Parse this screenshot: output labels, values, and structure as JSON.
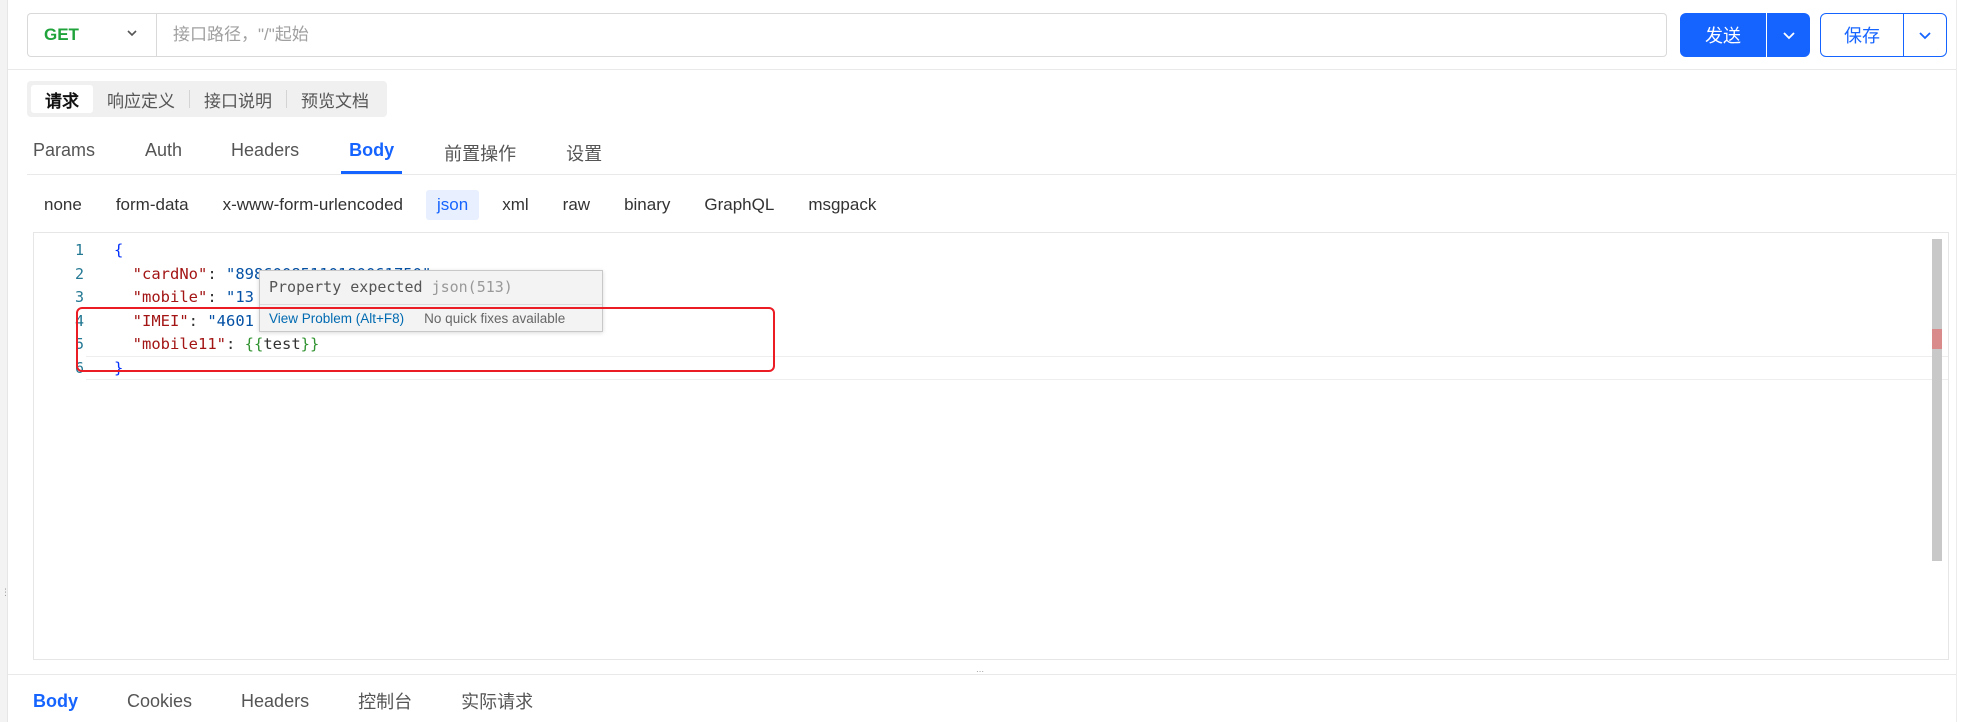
{
  "toolbar": {
    "method": "GET",
    "url_placeholder": "接口路径，\"/\"起始",
    "url_value": "",
    "send_label": "发送",
    "save_label": "保存"
  },
  "api_tabs": [
    {
      "label": "请求",
      "active": true
    },
    {
      "label": "响应定义",
      "active": false
    },
    {
      "label": "接口说明",
      "active": false
    },
    {
      "label": "预览文档",
      "active": false
    }
  ],
  "request_tabs": [
    {
      "label": "Params",
      "active": false
    },
    {
      "label": "Auth",
      "active": false
    },
    {
      "label": "Headers",
      "active": false
    },
    {
      "label": "Body",
      "active": true
    },
    {
      "label": "前置操作",
      "active": false
    },
    {
      "label": "设置",
      "active": false
    }
  ],
  "body_types": [
    {
      "label": "none",
      "active": false
    },
    {
      "label": "form-data",
      "active": false
    },
    {
      "label": "x-www-form-urlencoded",
      "active": false
    },
    {
      "label": "json",
      "active": true
    },
    {
      "label": "xml",
      "active": false
    },
    {
      "label": "raw",
      "active": false
    },
    {
      "label": "binary",
      "active": false
    },
    {
      "label": "GraphQL",
      "active": false
    },
    {
      "label": "msgpack",
      "active": false
    }
  ],
  "editor": {
    "line_numbers": [
      "1",
      "2",
      "3",
      "4",
      "5",
      "6"
    ],
    "lines": {
      "l1": "{",
      "l2_key": "\"cardNo\"",
      "l2_val": "\"89860085110180061750\"",
      "l3_key": "\"mobile\"",
      "l3_val": "\"13",
      "l4_key": "\"IMEI\"",
      "l4_val": "\"4601",
      "l5_key": "\"mobile11\"",
      "l5_open": "{{",
      "l5_text": "test",
      "l5_close": "}}",
      "l6": "}"
    },
    "colon": ": "
  },
  "hover": {
    "message": "Property expected",
    "source": "json(513)",
    "view_problem": "View Problem (Alt+F8)",
    "no_fix": "No quick fixes available"
  },
  "response_tabs": [
    {
      "label": "Body",
      "active": true
    },
    {
      "label": "Cookies",
      "active": false
    },
    {
      "label": "Headers",
      "active": false
    },
    {
      "label": "控制台",
      "active": false
    },
    {
      "label": "实际请求",
      "active": false
    }
  ],
  "colors": {
    "primary": "#1664ff",
    "method_get": "#1fa33a",
    "annotation_red": "#ec1c24"
  }
}
